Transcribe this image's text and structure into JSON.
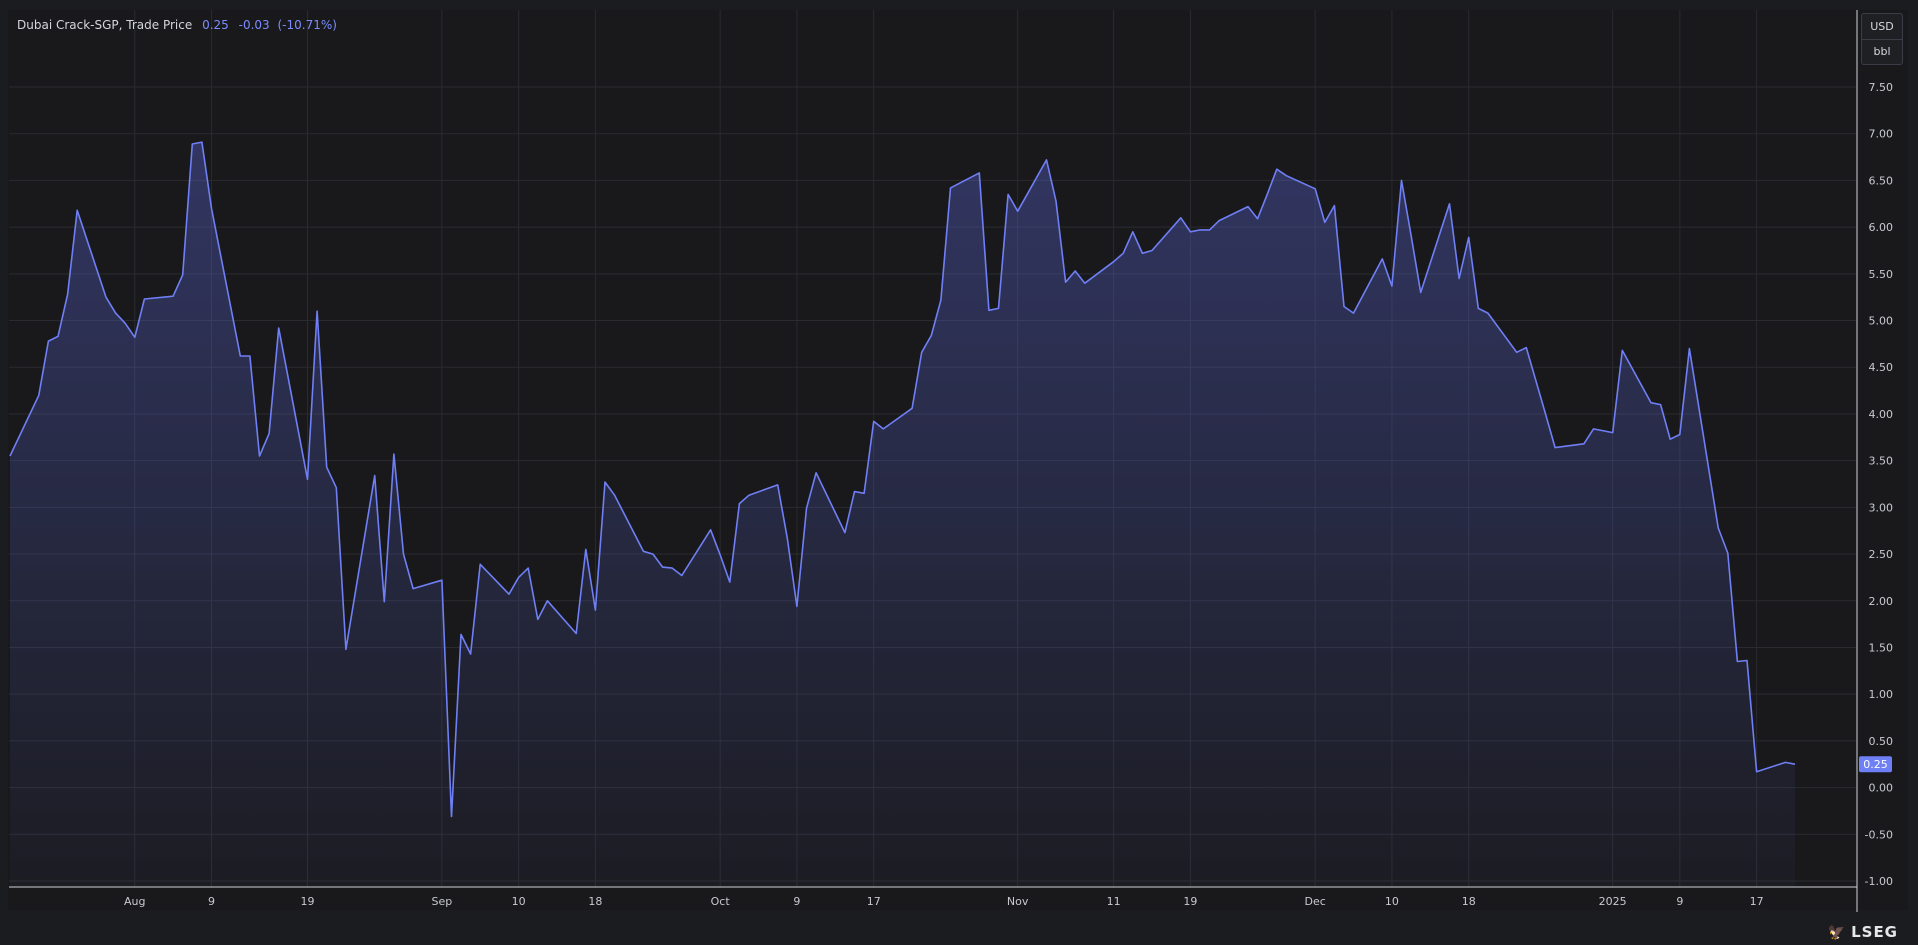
{
  "legend": {
    "title": "Dubai Crack-SGP, Trade Price",
    "last": "0.25",
    "change": "-0.03",
    "change_pct": "(-10.71%)"
  },
  "unit": {
    "currency": "USD",
    "measure": "bbl"
  },
  "logo": {
    "text": "LSEG",
    "icon": "lseg-bird-icon"
  },
  "colors": {
    "line": "#6f7ff5",
    "price_tag": "#6f7ff5",
    "background": "#19191b",
    "grid": "#2a2b30"
  },
  "chart_data": {
    "type": "area",
    "title": "Dubai Crack-SGP, Trade Price",
    "xlabel": "",
    "ylabel": "",
    "unit": "USD/bbl",
    "ylim": [
      -1.0,
      7.9
    ],
    "yticks": [
      "7.50",
      "7.00",
      "6.50",
      "6.00",
      "5.50",
      "5.00",
      "4.50",
      "4.00",
      "3.50",
      "3.00",
      "2.50",
      "2.00",
      "1.50",
      "1.00",
      "0.50",
      "0.00",
      "-0.50",
      "-1.00"
    ],
    "xlim": [
      "2024-07-19",
      "2025-01-21"
    ],
    "xticks": [
      {
        "date": "2024-08-01",
        "label": "Aug"
      },
      {
        "date": "2024-08-09",
        "label": "9"
      },
      {
        "date": "2024-08-19",
        "label": "19"
      },
      {
        "date": "2024-09-02",
        "label": "Sep"
      },
      {
        "date": "2024-09-10",
        "label": "10"
      },
      {
        "date": "2024-09-18",
        "label": "18"
      },
      {
        "date": "2024-10-01",
        "label": "Oct"
      },
      {
        "date": "2024-10-09",
        "label": "9"
      },
      {
        "date": "2024-10-17",
        "label": "17"
      },
      {
        "date": "2024-11-01",
        "label": "Nov"
      },
      {
        "date": "2024-11-11",
        "label": "11"
      },
      {
        "date": "2024-11-19",
        "label": "19"
      },
      {
        "date": "2024-12-02",
        "label": "Dec"
      },
      {
        "date": "2024-12-10",
        "label": "10"
      },
      {
        "date": "2024-12-18",
        "label": "18"
      },
      {
        "date": "2025-01-02",
        "label": "2025"
      },
      {
        "date": "2025-01-09",
        "label": "9"
      },
      {
        "date": "2025-01-17",
        "label": "17"
      }
    ],
    "last_value": 0.25,
    "grid": true,
    "legend": "top-left",
    "series": [
      {
        "name": "Dubai Crack-SGP, Trade Price",
        "points": [
          [
            "2024-07-19",
            3.55
          ],
          [
            "2024-07-22",
            4.2
          ],
          [
            "2024-07-23",
            4.78
          ],
          [
            "2024-07-24",
            4.83
          ],
          [
            "2024-07-25",
            5.28
          ],
          [
            "2024-07-26",
            6.18
          ],
          [
            "2024-07-29",
            5.25
          ],
          [
            "2024-07-30",
            5.08
          ],
          [
            "2024-07-31",
            4.97
          ],
          [
            "2024-08-01",
            4.82
          ],
          [
            "2024-08-02",
            5.23
          ],
          [
            "2024-08-05",
            5.26
          ],
          [
            "2024-08-06",
            5.49
          ],
          [
            "2024-08-07",
            6.89
          ],
          [
            "2024-08-08",
            6.91
          ],
          [
            "2024-08-09",
            6.2
          ],
          [
            "2024-08-12",
            4.62
          ],
          [
            "2024-08-13",
            4.62
          ],
          [
            "2024-08-14",
            3.55
          ],
          [
            "2024-08-15",
            3.79
          ],
          [
            "2024-08-16",
            4.92
          ],
          [
            "2024-08-19",
            3.3
          ],
          [
            "2024-08-20",
            5.1
          ],
          [
            "2024-08-21",
            3.43
          ],
          [
            "2024-08-22",
            3.21
          ],
          [
            "2024-08-23",
            1.48
          ],
          [
            "2024-08-26",
            3.34
          ],
          [
            "2024-08-27",
            1.99
          ],
          [
            "2024-08-28",
            3.57
          ],
          [
            "2024-08-29",
            2.5
          ],
          [
            "2024-08-30",
            2.13
          ],
          [
            "2024-09-02",
            2.22
          ],
          [
            "2024-09-03",
            -0.31
          ],
          [
            "2024-09-04",
            1.64
          ],
          [
            "2024-09-05",
            1.43
          ],
          [
            "2024-09-06",
            2.39
          ],
          [
            "2024-09-09",
            2.07
          ],
          [
            "2024-09-10",
            2.25
          ],
          [
            "2024-09-11",
            2.35
          ],
          [
            "2024-09-12",
            1.8
          ],
          [
            "2024-09-13",
            2.0
          ],
          [
            "2024-09-16",
            1.65
          ],
          [
            "2024-09-17",
            2.55
          ],
          [
            "2024-09-18",
            1.9
          ],
          [
            "2024-09-19",
            3.27
          ],
          [
            "2024-09-20",
            3.13
          ],
          [
            "2024-09-23",
            2.53
          ],
          [
            "2024-09-24",
            2.5
          ],
          [
            "2024-09-25",
            2.36
          ],
          [
            "2024-09-26",
            2.35
          ],
          [
            "2024-09-27",
            2.27
          ],
          [
            "2024-09-30",
            2.76
          ],
          [
            "2024-10-01",
            2.49
          ],
          [
            "2024-10-02",
            2.2
          ],
          [
            "2024-10-03",
            3.04
          ],
          [
            "2024-10-04",
            3.13
          ],
          [
            "2024-10-07",
            3.24
          ],
          [
            "2024-10-08",
            2.67
          ],
          [
            "2024-10-09",
            1.94
          ],
          [
            "2024-10-10",
            2.99
          ],
          [
            "2024-10-11",
            3.37
          ],
          [
            "2024-10-14",
            2.73
          ],
          [
            "2024-10-15",
            3.17
          ],
          [
            "2024-10-16",
            3.15
          ],
          [
            "2024-10-17",
            3.92
          ],
          [
            "2024-10-18",
            3.84
          ],
          [
            "2024-10-21",
            4.06
          ],
          [
            "2024-10-22",
            4.66
          ],
          [
            "2024-10-23",
            4.84
          ],
          [
            "2024-10-24",
            5.22
          ],
          [
            "2024-10-25",
            6.42
          ],
          [
            "2024-10-28",
            6.58
          ],
          [
            "2024-10-29",
            5.11
          ],
          [
            "2024-10-30",
            5.13
          ],
          [
            "2024-10-31",
            6.35
          ],
          [
            "2024-11-01",
            6.17
          ],
          [
            "2024-11-04",
            6.72
          ],
          [
            "2024-11-05",
            6.28
          ],
          [
            "2024-11-06",
            5.41
          ],
          [
            "2024-11-07",
            5.53
          ],
          [
            "2024-11-08",
            5.4
          ],
          [
            "2024-11-11",
            5.63
          ],
          [
            "2024-11-12",
            5.72
          ],
          [
            "2024-11-13",
            5.95
          ],
          [
            "2024-11-14",
            5.72
          ],
          [
            "2024-11-15",
            5.75
          ],
          [
            "2024-11-18",
            6.1
          ],
          [
            "2024-11-19",
            5.95
          ],
          [
            "2024-11-20",
            5.97
          ],
          [
            "2024-11-21",
            5.97
          ],
          [
            "2024-11-22",
            6.07
          ],
          [
            "2024-11-25",
            6.22
          ],
          [
            "2024-11-26",
            6.09
          ],
          [
            "2024-11-27",
            6.35
          ],
          [
            "2024-11-28",
            6.62
          ],
          [
            "2024-11-29",
            6.55
          ],
          [
            "2024-12-02",
            6.41
          ],
          [
            "2024-12-03",
            6.05
          ],
          [
            "2024-12-04",
            6.23
          ],
          [
            "2024-12-05",
            5.15
          ],
          [
            "2024-12-06",
            5.08
          ],
          [
            "2024-12-09",
            5.66
          ],
          [
            "2024-12-10",
            5.37
          ],
          [
            "2024-12-11",
            6.5
          ],
          [
            "2024-12-12",
            5.91
          ],
          [
            "2024-12-13",
            5.3
          ],
          [
            "2024-12-16",
            6.25
          ],
          [
            "2024-12-17",
            5.45
          ],
          [
            "2024-12-18",
            5.89
          ],
          [
            "2024-12-19",
            5.13
          ],
          [
            "2024-12-20",
            5.08
          ],
          [
            "2024-12-23",
            4.66
          ],
          [
            "2024-12-24",
            4.71
          ],
          [
            "2024-12-26",
            4.0
          ],
          [
            "2024-12-27",
            3.64
          ],
          [
            "2024-12-30",
            3.68
          ],
          [
            "2024-12-31",
            3.84
          ],
          [
            "2025-01-02",
            3.8
          ],
          [
            "2025-01-03",
            4.68
          ],
          [
            "2025-01-06",
            4.12
          ],
          [
            "2025-01-07",
            4.1
          ],
          [
            "2025-01-08",
            3.73
          ],
          [
            "2025-01-09",
            3.78
          ],
          [
            "2025-01-10",
            4.7
          ],
          [
            "2025-01-13",
            2.78
          ],
          [
            "2025-01-14",
            2.51
          ],
          [
            "2025-01-15",
            1.35
          ],
          [
            "2025-01-16",
            1.36
          ],
          [
            "2025-01-17",
            0.17
          ],
          [
            "2025-01-20",
            0.27
          ],
          [
            "2025-01-21",
            0.25
          ]
        ]
      }
    ]
  }
}
